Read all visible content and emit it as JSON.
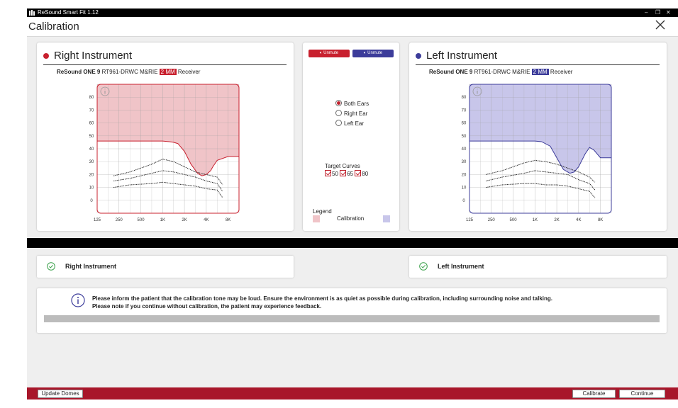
{
  "window": {
    "app_title": "ReSound Smart Fit 1.12",
    "controls": {
      "minimize": "–",
      "restore": "❐",
      "close": "✕"
    }
  },
  "header": {
    "page_title": "Calibration"
  },
  "right_instrument": {
    "title": "Right Instrument",
    "model_bold": "ReSound ONE 9",
    "model": "RT961-DRWC M&RIE",
    "receiver_badge": "2 MM",
    "receiver_label": "Receiver",
    "color": "#c8202e",
    "fill_color": "#f0c4c8"
  },
  "left_instrument": {
    "title": "Left Instrument",
    "model_bold": "ReSound ONE 9",
    "model": "RT961-DRWC M&RIE",
    "receiver_badge": "2 MM",
    "receiver_label": "Receiver",
    "color": "#3c3c9a",
    "fill_color": "#c8c6ea"
  },
  "center": {
    "unmute_right": "Unmute",
    "unmute_left": "Unmute",
    "ear_options": [
      {
        "label": "Both Ears",
        "selected": true
      },
      {
        "label": "Right Ear",
        "selected": false
      },
      {
        "label": "Left Ear",
        "selected": false
      }
    ],
    "target_curves_label": "Target Curves",
    "target_curves": [
      "50",
      "65",
      "80"
    ],
    "legend_title": "Legend",
    "legend_label": "Calibration"
  },
  "status": {
    "right_label": "Right Instrument",
    "left_label": "Left Instrument"
  },
  "notice": {
    "line1": "Please inform the patient that the calibration tone may be loud.  Ensure the environment is as quiet as possible during calibration, including surrounding noise and talking.",
    "line2": "Please note if you continue without calibration, the patient may experience feedback.",
    "progress": 0
  },
  "footer": {
    "update_domes": "Update Domes",
    "calibrate": "Calibrate",
    "continue": "Continue"
  },
  "chart_data": [
    {
      "type": "area",
      "name": "Right Instrument",
      "x_tick_labels": [
        "125",
        "250",
        "500",
        "1K",
        "2K",
        "4K",
        "8K"
      ],
      "y_tick_labels": [
        "0",
        "10",
        "20",
        "30",
        "40",
        "50",
        "60",
        "70",
        "80"
      ],
      "ylim": [
        -10,
        90
      ],
      "x_index": [
        0,
        1,
        2,
        3,
        3.3,
        3.5,
        3.7,
        4,
        4.3,
        4.6,
        4.8,
        5,
        5.2,
        5.3,
        5.5,
        6,
        6.5
      ],
      "calibration": [
        46,
        46,
        46,
        46,
        45.5,
        45,
        44,
        38,
        28,
        21,
        19,
        20,
        23,
        26,
        31,
        34,
        34
      ],
      "target_curves": [
        {
          "name": "80",
          "x": [
            0.75,
            1.5,
            2.5,
            3,
            3.5,
            4,
            4.5,
            5,
            5.5,
            5.75
          ],
          "values": [
            19,
            22,
            28,
            32,
            30,
            26,
            22,
            20,
            18,
            12
          ]
        },
        {
          "name": "65",
          "x": [
            0.75,
            1.5,
            2.5,
            3,
            3.5,
            4,
            4.5,
            5,
            5.5,
            5.75
          ],
          "values": [
            15,
            17,
            21,
            23,
            22,
            20,
            18,
            15,
            13,
            7
          ]
        },
        {
          "name": "50",
          "x": [
            0.75,
            1.5,
            2.5,
            3,
            3.5,
            4,
            4.5,
            5,
            5.5,
            5.75
          ],
          "values": [
            10,
            12,
            13,
            14,
            13,
            12,
            11,
            9,
            8,
            2
          ]
        }
      ]
    },
    {
      "type": "area",
      "name": "Left Instrument",
      "x_tick_labels": [
        "125",
        "250",
        "500",
        "1K",
        "2K",
        "4K",
        "8K"
      ],
      "y_tick_labels": [
        "0",
        "10",
        "20",
        "30",
        "40",
        "50",
        "60",
        "70",
        "80"
      ],
      "ylim": [
        -10,
        90
      ],
      "x_index": [
        0,
        1,
        2,
        3,
        3.3,
        3.7,
        4,
        4.3,
        4.6,
        4.8,
        5,
        5.3,
        5.5,
        5.7,
        6,
        6.5
      ],
      "calibration": [
        46,
        46,
        46,
        46,
        45.5,
        42,
        33,
        24,
        21,
        22,
        26,
        36,
        41,
        39,
        33,
        33
      ],
      "target_curves": [
        {
          "name": "80",
          "x": [
            0.75,
            1.5,
            2.5,
            3,
            3.5,
            4,
            4.5,
            5,
            5.5,
            5.75
          ],
          "values": [
            20,
            23,
            29,
            31,
            30,
            28,
            25,
            22,
            18,
            14
          ]
        },
        {
          "name": "65",
          "x": [
            0.75,
            1.5,
            2.5,
            3,
            3.5,
            4,
            4.5,
            5,
            5.5,
            5.75
          ],
          "values": [
            15,
            18,
            21,
            23,
            22,
            21,
            20,
            16,
            13,
            8
          ]
        },
        {
          "name": "50",
          "x": [
            0.75,
            1.5,
            2.5,
            3,
            3.5,
            4,
            4.5,
            5,
            5.5,
            5.75
          ],
          "values": [
            10,
            12,
            13,
            13,
            12,
            12,
            11,
            9,
            7,
            2
          ]
        }
      ]
    }
  ]
}
